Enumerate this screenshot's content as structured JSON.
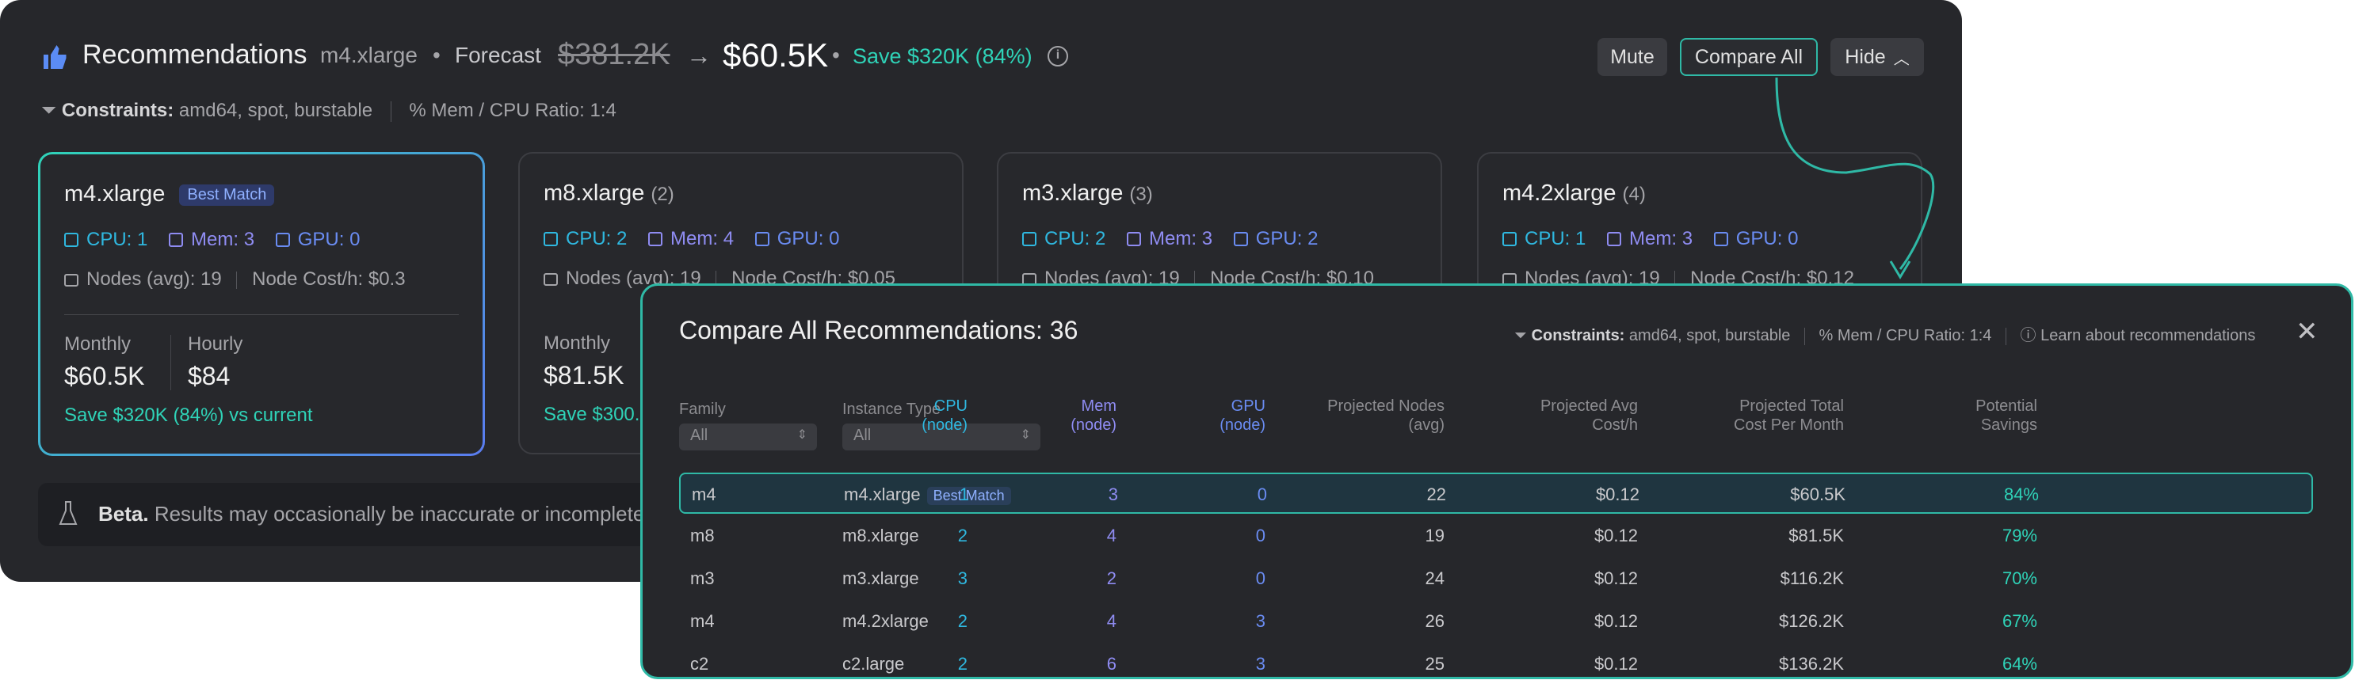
{
  "header": {
    "title": "Recommendations",
    "instance": "m4.xlarge",
    "forecast_label": "Forecast",
    "price_old": "$381.2K",
    "price_new": "$60.5K",
    "save": "Save $320K (84%)",
    "buttons": {
      "mute": "Mute",
      "compare": "Compare All",
      "hide": "Hide"
    }
  },
  "constraints": {
    "label": "Constraints:",
    "value": "amd64, spot, burstable",
    "ratio": "Mem / CPU Ratio: 1:4"
  },
  "cards": [
    {
      "title": "m4.xlarge",
      "badge": "Best Match",
      "cpu": "CPU: 1",
      "mem": "Mem: 3",
      "gpu": "GPU: 0",
      "nodes": "Nodes (avg): 19",
      "cost": "Node Cost/h: $0.3",
      "monthly_label": "Monthly",
      "monthly": "$60.5K",
      "hourly_label": "Hourly",
      "hourly": "$84",
      "save": "Save $320K (84%) vs current"
    },
    {
      "title": "m8.xlarge",
      "count": "(2)",
      "cpu": "CPU: 2",
      "mem": "Mem: 4",
      "gpu": "GPU: 0",
      "nodes": "Nodes (avg): 19",
      "cost": "Node Cost/h: $0.05",
      "monthly_label": "Monthly",
      "monthly": "$81.5K",
      "save": "Save $300."
    },
    {
      "title": "m3.xlarge",
      "count": "(3)",
      "cpu": "CPU: 2",
      "mem": "Mem: 3",
      "gpu": "GPU: 2",
      "nodes": "Nodes (avg): 19",
      "cost": "Node Cost/h: $0.10"
    },
    {
      "title": "m4.2xlarge",
      "count": "(4)",
      "cpu": "CPU: 1",
      "mem": "Mem: 3",
      "gpu": "GPU: 0",
      "nodes": "Nodes (avg): 19",
      "cost": "Node Cost/h: $0.12"
    }
  ],
  "beta": {
    "label": "Beta.",
    "text": "Results may occasionally be inaccurate or incomplete. We"
  },
  "compare": {
    "title": "Compare All Recommendations: 36",
    "constraints_label": "Constraints:",
    "constraints_value": "amd64, spot, burstable",
    "ratio": "Mem / CPU Ratio: 1:4",
    "learn": "Learn about recommendations",
    "columns": {
      "family": "Family",
      "instance": "Instance Type",
      "cpu1": "CPU",
      "cpu2": "(node)",
      "mem1": "Mem",
      "mem2": "(node)",
      "gpu1": "GPU",
      "gpu2": "(node)",
      "nodes1": "Projected Nodes",
      "nodes2": "(avg)",
      "cost1": "Projected Avg",
      "cost2": "Cost/h",
      "total1": "Projected Total",
      "total2": "Cost Per Month",
      "sav1": "Potential",
      "sav2": "Savings"
    },
    "filters": {
      "family": "All",
      "instance": "All"
    },
    "rows": [
      {
        "family": "m4",
        "instance": "m4.xlarge",
        "badge": "Best Match",
        "cpu": "1",
        "mem": "3",
        "gpu": "0",
        "nodes": "22",
        "cost": "$0.12",
        "total": "$60.5K",
        "savings": "84%"
      },
      {
        "family": "m8",
        "instance": "m8.xlarge",
        "cpu": "2",
        "mem": "4",
        "gpu": "0",
        "nodes": "19",
        "cost": "$0.12",
        "total": "$81.5K",
        "savings": "79%"
      },
      {
        "family": "m3",
        "instance": "m3.xlarge",
        "cpu": "3",
        "mem": "2",
        "gpu": "0",
        "nodes": "24",
        "cost": "$0.12",
        "total": "$116.2K",
        "savings": "70%"
      },
      {
        "family": "m4",
        "instance": "m4.2xlarge",
        "cpu": "2",
        "mem": "4",
        "gpu": "3",
        "nodes": "26",
        "cost": "$0.12",
        "total": "$126.2K",
        "savings": "67%"
      },
      {
        "family": "c2",
        "instance": "c2.large",
        "cpu": "2",
        "mem": "6",
        "gpu": "3",
        "nodes": "25",
        "cost": "$0.12",
        "total": "$136.2K",
        "savings": "64%"
      }
    ]
  },
  "colors": {
    "accent": "#2fd3b8",
    "cpu": "#2fb8e0",
    "mem": "#8f8cf2",
    "gpu": "#6a8cf2",
    "panel": "#26272b"
  }
}
